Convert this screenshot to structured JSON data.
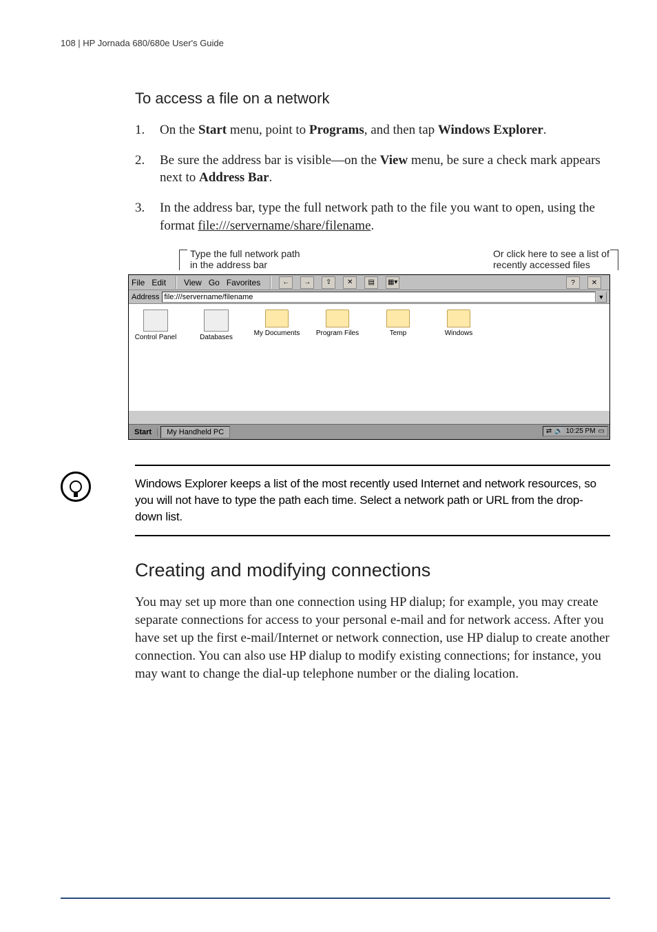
{
  "header": {
    "text": "108 | HP Jornada 680/680e User's Guide"
  },
  "section": {
    "title": "To access a file on a network"
  },
  "steps": [
    {
      "num": "1.",
      "pre": "On the ",
      "b1": "Start",
      "mid1": " menu, point to ",
      "b2": "Programs",
      "mid2": ", and then tap ",
      "b3": "Windows Explorer",
      "post": "."
    },
    {
      "num": "2.",
      "pre": "Be sure the address bar is visible—on the ",
      "b1": "View",
      "mid1": " menu, be sure a check mark appears next to ",
      "b2": "Address Bar",
      "post": "."
    },
    {
      "num": "3.",
      "pre": "In the address bar, type the full network path to the file you want to open, using the format ",
      "u1": "file:///servername/share/filename",
      "post": "."
    }
  ],
  "fig": {
    "label_left_line1": "Type the full network path",
    "label_left_line2": "in the address bar",
    "label_right_line1": "Or click here to see a list of",
    "label_right_line2": "recently accessed files",
    "menu": {
      "file": "File",
      "edit": "Edit",
      "view": "View",
      "go": "Go",
      "favorites": "Favorites"
    },
    "addr_label": "Address",
    "addr_value": "file:///servername/filename",
    "icons": [
      {
        "label": "Control Panel"
      },
      {
        "label": "Databases"
      },
      {
        "label": "My Documents"
      },
      {
        "label": "Program Files"
      },
      {
        "label": "Temp"
      },
      {
        "label": "Windows"
      }
    ],
    "taskbar_start": "Start",
    "taskbar_app": "My Handheld PC",
    "taskbar_time": "10:25 PM"
  },
  "tip": {
    "text": "Windows Explorer keeps a list of the most recently used Internet and network resources, so you will not have to type the path each time. Select a network path or URL from the drop-down list."
  },
  "h2": {
    "title": "Creating and modifying connections"
  },
  "para": {
    "text": "You may set up more than one connection using HP dialup; for example, you may create separate connections for access to your personal e-mail and for network access. After you have set up the first e-mail/Internet or network connection, use HP dialup to create another connection. You can also use HP dialup to modify existing connections; for instance, you may want to change the dial-up telephone number or the dialing location."
  }
}
